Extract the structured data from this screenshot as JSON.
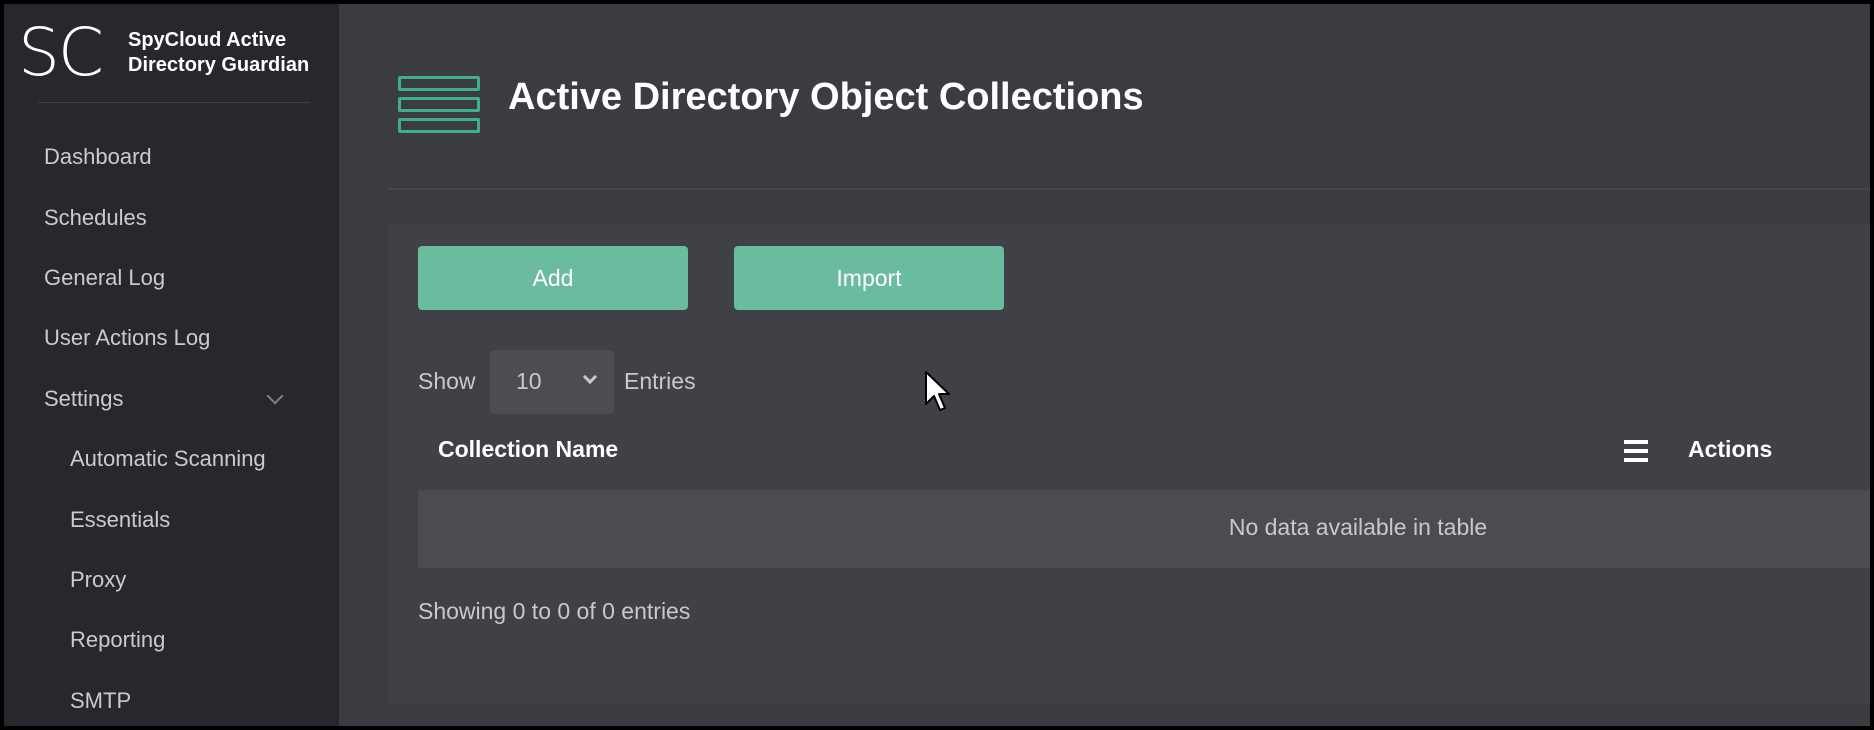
{
  "brand": {
    "logo": "SC",
    "name_line1": "SpyCloud Active",
    "name_line2": "Directory Guardian"
  },
  "sidebar": {
    "items": [
      {
        "label": "Dashboard"
      },
      {
        "label": "Schedules"
      },
      {
        "label": "General Log"
      },
      {
        "label": "User Actions Log"
      },
      {
        "label": "Settings",
        "icon": "chevron-down-icon"
      }
    ],
    "settings_children": [
      {
        "label": "Automatic Scanning"
      },
      {
        "label": "Essentials"
      },
      {
        "label": "Proxy"
      },
      {
        "label": "Reporting"
      },
      {
        "label": "SMTP"
      }
    ]
  },
  "page": {
    "icon": "collection-stack-icon",
    "title": "Active Directory Object Collections"
  },
  "toolbar": {
    "add_label": "Add",
    "import_label": "Import"
  },
  "length": {
    "show_label": "Show",
    "selected": "10",
    "entries_label": "Entries"
  },
  "table": {
    "columns": [
      "Collection Name",
      "Actions"
    ],
    "column_toggle_icon": "menu-icon",
    "empty_message": "No data available in table",
    "info": "Showing 0 to 0 of 0 entries"
  },
  "colors": {
    "accent": "#6bbb9e",
    "sidebar_bg": "#27282d",
    "content_bg": "#3a3c42"
  }
}
